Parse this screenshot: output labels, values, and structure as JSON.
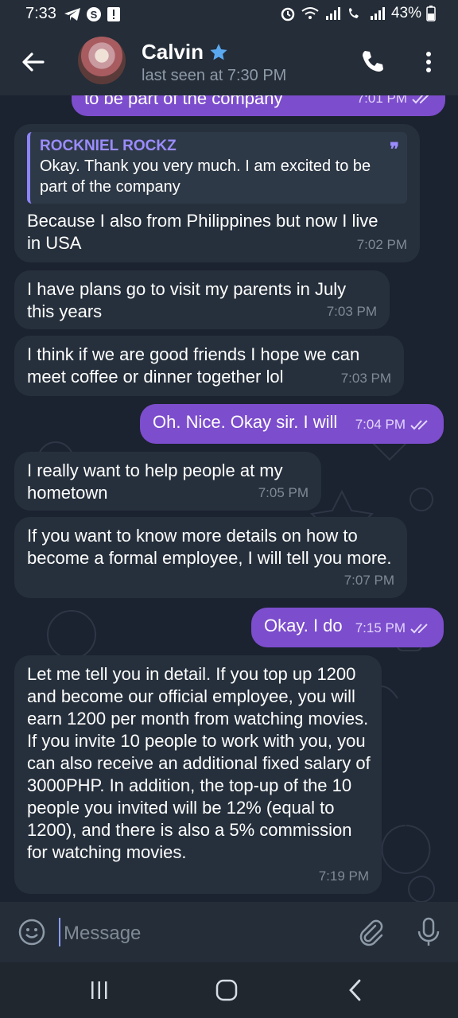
{
  "status_bar": {
    "time": "7:33",
    "battery": "43%"
  },
  "header": {
    "contact_name": "Calvin",
    "last_seen": "last seen at 7:30 PM"
  },
  "messages": [
    {
      "direction": "out",
      "text": "to be part of the company",
      "time": "7:01 PM",
      "read": true
    },
    {
      "direction": "in",
      "reply_to": {
        "name": "ROCKNIEL ROCKZ",
        "text": "Okay. Thank you very much. I am excited to be part of the company"
      },
      "text": "Because I also from Philippines but now I live in USA",
      "time": "7:02 PM"
    },
    {
      "direction": "in",
      "text": "I have plans go to visit my parents in July this years",
      "time": "7:03 PM"
    },
    {
      "direction": "in",
      "text": "I think if we are good friends I hope we can meet coffee or dinner together lol",
      "time": "7:03 PM"
    },
    {
      "direction": "out",
      "text": "Oh. Nice. Okay sir. I will",
      "time": "7:04 PM",
      "read": true
    },
    {
      "direction": "in",
      "text": "I really want to help people at my hometown",
      "time": "7:05 PM"
    },
    {
      "direction": "in",
      "text": "If you want to know more details on how to become a formal employee, I will tell you more.",
      "time": "7:07 PM"
    },
    {
      "direction": "out",
      "text": "Okay. I do",
      "time": "7:15 PM",
      "read": true
    },
    {
      "direction": "in",
      "text": "Let me tell you in detail. If you top up 1200 and become our official employee, you will earn 1200 per month from watching movies. If you invite 10 people to work with you, you can also receive an additional fixed salary of 3000PHP. In addition, the top-up of the 10 people you invited will be 12% (equal to 1200), and there is also a 5% commission for watching movies.",
      "time": "7:19 PM"
    }
  ],
  "input": {
    "placeholder": "Message"
  },
  "colors": {
    "outgoing_bubble": "#7c4dcc",
    "incoming_bubble": "#26303c",
    "header": "#242d38",
    "accent": "#9b8cff"
  }
}
